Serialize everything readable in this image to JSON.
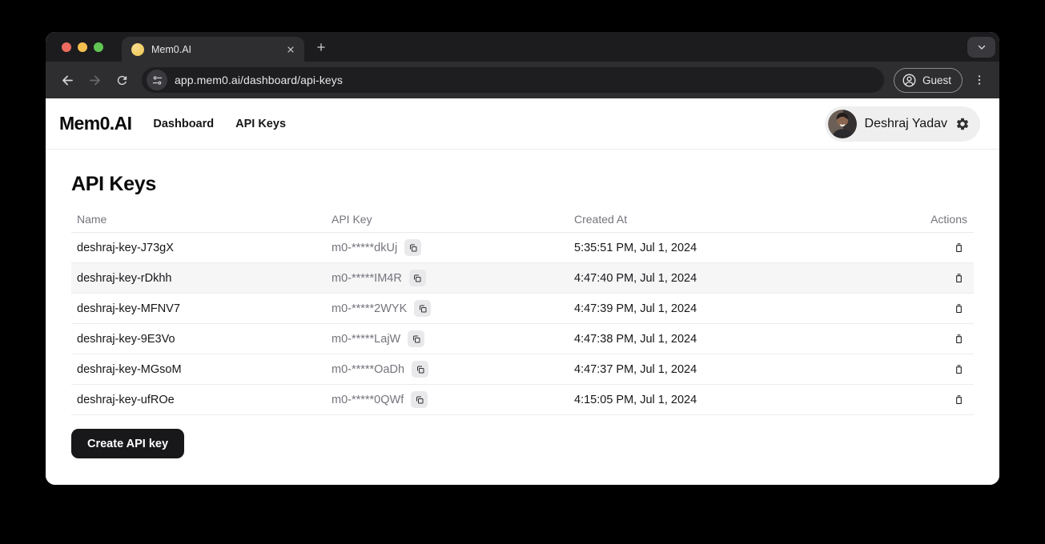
{
  "browser": {
    "tab_title": "Mem0.AI",
    "url": "app.mem0.ai/dashboard/api-keys",
    "guest_label": "Guest"
  },
  "header": {
    "logo": "Mem0.AI",
    "nav": [
      {
        "label": "Dashboard"
      },
      {
        "label": "API Keys"
      }
    ],
    "user_name": "Deshraj Yadav"
  },
  "main": {
    "title": "API Keys",
    "create_button_label": "Create API key",
    "table": {
      "columns": [
        "Name",
        "API Key",
        "Created At",
        "Actions"
      ],
      "rows": [
        {
          "name": "deshraj-key-J73gX",
          "api_key": "m0-*****dkUj",
          "created_at": "5:35:51 PM, Jul 1, 2024",
          "highlighted": false
        },
        {
          "name": "deshraj-key-rDkhh",
          "api_key": "m0-*****IM4R",
          "created_at": "4:47:40 PM, Jul 1, 2024",
          "highlighted": true
        },
        {
          "name": "deshraj-key-MFNV7",
          "api_key": "m0-*****2WYK",
          "created_at": "4:47:39 PM, Jul 1, 2024",
          "highlighted": false
        },
        {
          "name": "deshraj-key-9E3Vo",
          "api_key": "m0-*****LajW",
          "created_at": "4:47:38 PM, Jul 1, 2024",
          "highlighted": false
        },
        {
          "name": "deshraj-key-MGsoM",
          "api_key": "m0-*****OaDh",
          "created_at": "4:47:37 PM, Jul 1, 2024",
          "highlighted": false
        },
        {
          "name": "deshraj-key-ufROe",
          "api_key": "m0-*****0QWf",
          "created_at": "4:15:05 PM, Jul 1, 2024",
          "highlighted": false
        }
      ]
    }
  },
  "icons": {
    "copy": "two-overlapping-squares",
    "delete": "trash-outline",
    "settings": "gear",
    "guest": "person-in-circle",
    "site_info": "tune-sliders",
    "browser_menu": "three-dots-vertical"
  },
  "colors": {
    "traffic_red": "#ee6a5f",
    "traffic_yellow": "#f5bf4f",
    "traffic_green": "#61c554",
    "favicon": "#eec34f",
    "tabstrip_bg": "#1c1c1e",
    "toolbar_bg": "#2e2e30",
    "urlbar_bg": "#1e1e20",
    "page_bg": "#ffffff",
    "create_button_bg": "#18181b",
    "row_highlight_bg": "#f6f6f7",
    "muted_text": "#74747c",
    "row_border": "#ececee"
  }
}
